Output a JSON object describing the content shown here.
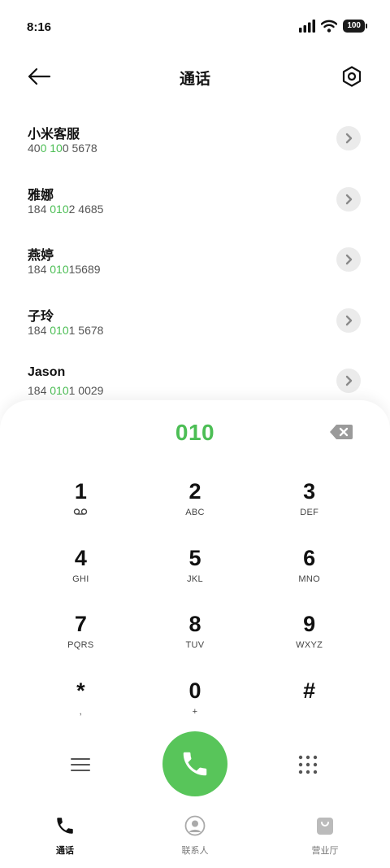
{
  "status_bar": {
    "time": "8:16",
    "battery": "100"
  },
  "header": {
    "title": "通话"
  },
  "contacts": [
    {
      "name": "小米客服",
      "number_parts": [
        "40",
        "0 10",
        "0 5678"
      ]
    },
    {
      "name": "雅娜",
      "number_parts": [
        "184 ",
        "010",
        "2 4685"
      ]
    },
    {
      "name": "燕婷",
      "number_parts": [
        "184 ",
        "010",
        "15689"
      ]
    },
    {
      "name": "子玲",
      "number_parts": [
        "184 ",
        "010",
        "1 5678"
      ]
    },
    {
      "name": "Jason",
      "number_parts": [
        "184 ",
        "010",
        "1 0029"
      ]
    }
  ],
  "dialer": {
    "input": "010",
    "keys": [
      {
        "digit": "1",
        "sub": ""
      },
      {
        "digit": "2",
        "sub": "ABC"
      },
      {
        "digit": "3",
        "sub": "DEF"
      },
      {
        "digit": "4",
        "sub": "GHI"
      },
      {
        "digit": "5",
        "sub": "JKL"
      },
      {
        "digit": "6",
        "sub": "MNO"
      },
      {
        "digit": "7",
        "sub": "PQRS"
      },
      {
        "digit": "8",
        "sub": "TUV"
      },
      {
        "digit": "9",
        "sub": "WXYZ"
      },
      {
        "digit": "*",
        "sub": ","
      },
      {
        "digit": "0",
        "sub": "+"
      },
      {
        "digit": "#",
        "sub": ""
      }
    ]
  },
  "bottom_nav": [
    {
      "label": "通话",
      "icon": "phone-icon",
      "active": true
    },
    {
      "label": "联系人",
      "icon": "contacts-icon",
      "active": false
    },
    {
      "label": "营业厅",
      "icon": "shopping-bag-icon",
      "active": false
    }
  ],
  "colors": {
    "accent": "#4cbe55",
    "call_button": "#58c55a",
    "detail_button_bg": "#ebebeb"
  },
  "icons": {
    "voicemail": "voicemail-icon",
    "back": "arrow-left-icon",
    "settings": "hexagon-gear-icon",
    "backspace": "backspace-icon",
    "menu": "menu-icon",
    "dialpad": "dialpad-grid-icon"
  }
}
